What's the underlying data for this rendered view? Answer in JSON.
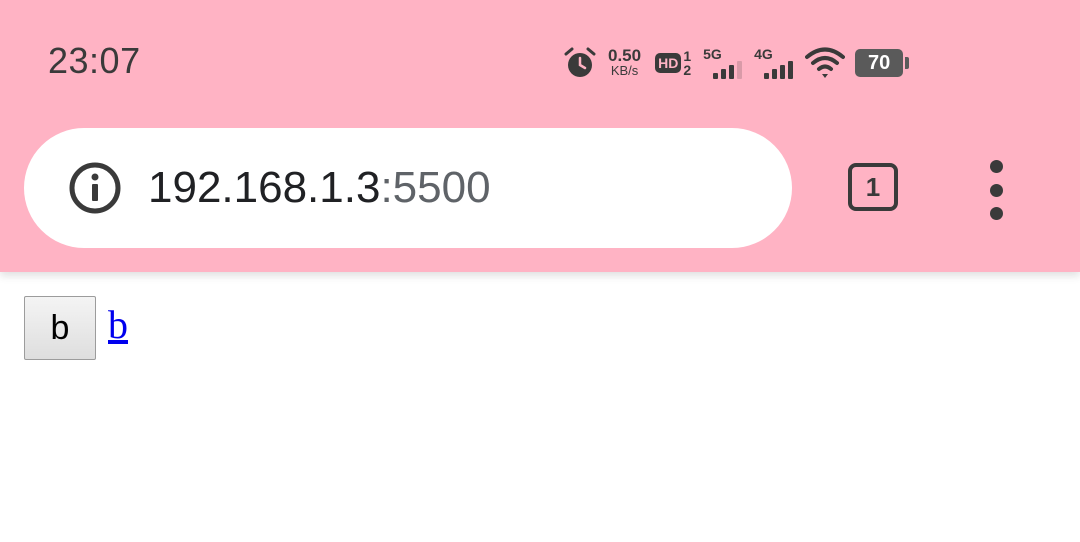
{
  "status_bar": {
    "time": "23:07",
    "net_speed_value": "0.50",
    "net_speed_unit": "KB/s",
    "hd_label": "HD",
    "hd_sim_top": "1",
    "hd_sim_bottom": "2",
    "sim1_network": "5G",
    "sim2_network": "4G",
    "battery_level": "70",
    "icons": [
      "alarm-icon",
      "hd-voice-icon",
      "signal-5g-icon",
      "signal-4g-icon",
      "wifi-icon",
      "battery-icon"
    ]
  },
  "toolbar": {
    "url_host": "192.168.1.3",
    "url_port": ":5500",
    "tab_count": "1",
    "icons": [
      "info-icon",
      "tab-switcher-icon",
      "more-vert-icon"
    ]
  },
  "page": {
    "button_label": "b",
    "link_text": "b"
  },
  "colors": {
    "toolbar_bg": "#ffb3c4",
    "link": "#0000ee"
  }
}
